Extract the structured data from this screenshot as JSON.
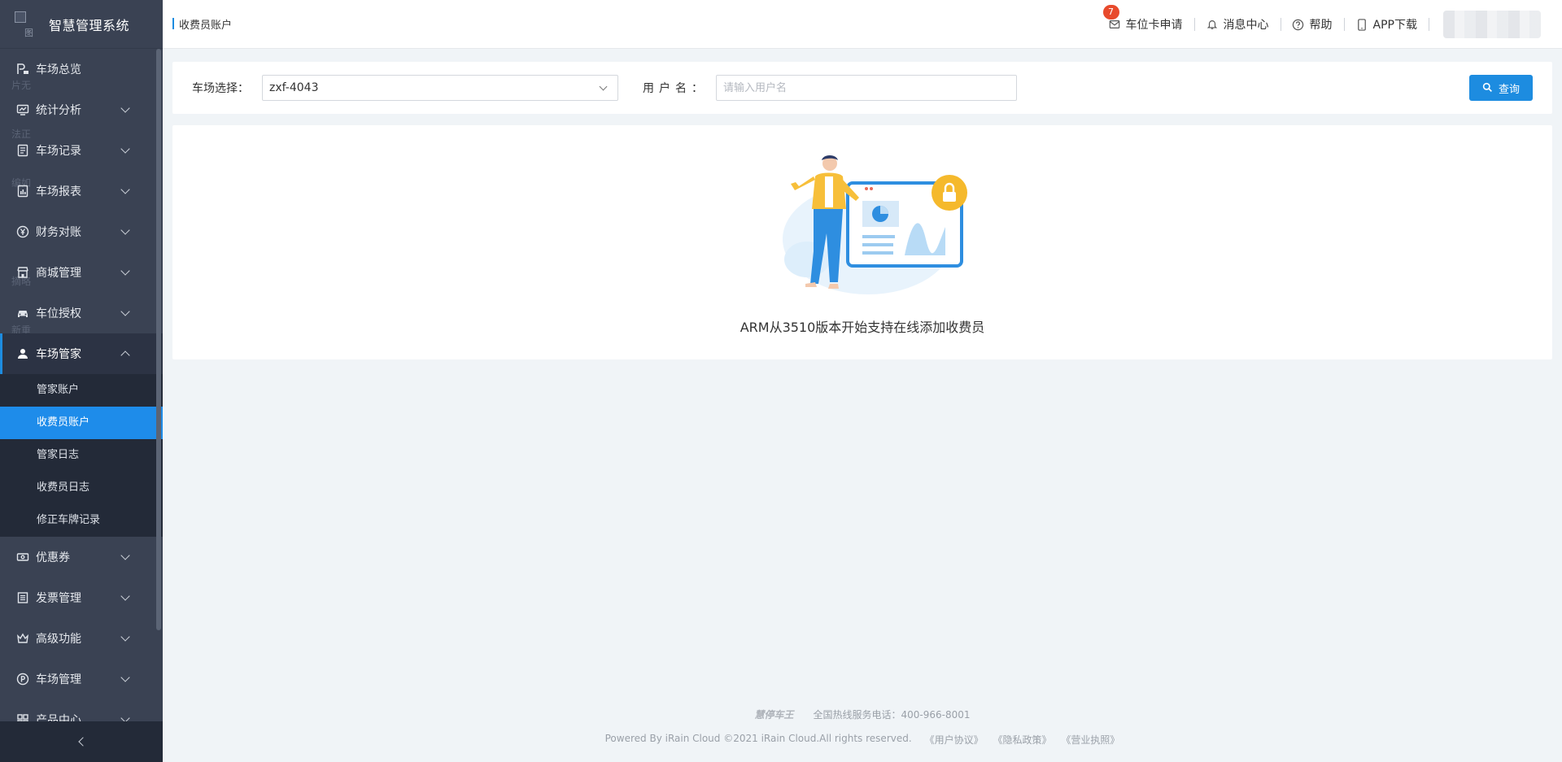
{
  "app": {
    "title": "智慧管理系统",
    "logo_alt": "图"
  },
  "sidebar": {
    "items": [
      {
        "label": "车场总览",
        "icon": "parking-overview-icon",
        "expandable": false
      },
      {
        "label": "统计分析",
        "icon": "chart-icon",
        "expandable": true
      },
      {
        "label": "车场记录",
        "icon": "record-icon",
        "expandable": true
      },
      {
        "label": "车场报表",
        "icon": "report-icon",
        "expandable": true
      },
      {
        "label": "财务对账",
        "icon": "yen-icon",
        "expandable": true
      },
      {
        "label": "商城管理",
        "icon": "store-icon",
        "expandable": true
      },
      {
        "label": "车位授权",
        "icon": "car-icon",
        "expandable": true
      },
      {
        "label": "车场管家",
        "icon": "user-icon",
        "expandable": true,
        "open": true
      },
      {
        "label": "优惠券",
        "icon": "coupon-icon",
        "expandable": true
      },
      {
        "label": "发票管理",
        "icon": "invoice-icon",
        "expandable": true
      },
      {
        "label": "高级功能",
        "icon": "crown-icon",
        "expandable": true
      },
      {
        "label": "车场管理",
        "icon": "parking-icon",
        "expandable": true
      },
      {
        "label": "产品中心",
        "icon": "product-icon",
        "expandable": true
      }
    ],
    "submenu": [
      "管家账户",
      "收费员账户",
      "管家日志",
      "收费员日志",
      "修正车牌记录"
    ],
    "active_sub": "收费员账户",
    "ghost_labels": [
      "片无",
      "法正",
      "编如",
      "摘略",
      "新重"
    ]
  },
  "header": {
    "breadcrumb": "收费员账户",
    "actions": [
      {
        "label": "车位卡申请",
        "icon": "mail-icon",
        "badge": "7"
      },
      {
        "label": "消息中心",
        "icon": "bell-icon"
      },
      {
        "label": "帮助",
        "icon": "help-icon"
      },
      {
        "label": "APP下载",
        "icon": "phone-icon"
      }
    ]
  },
  "filter": {
    "park_label": "车场选择：",
    "park_value": "zxf-4043",
    "user_label": "用户名：",
    "user_placeholder": "请输入用户名",
    "query_label": "查询"
  },
  "empty": {
    "message": "ARM从3510版本开始支持在线添加收费员"
  },
  "footer": {
    "brand": "慧停车王",
    "hotline": "全国热线服务电话：400-966-8001",
    "copyright": "Powered By iRain Cloud ©2021 iRain Cloud.All rights reserved.",
    "links": [
      "《用户协议》",
      "《隐私政策》",
      "《营业执照》"
    ]
  },
  "colors": {
    "sidebar_bg": "#3a4253",
    "accent": "#1d8ce0",
    "badge": "#e84a2c"
  }
}
